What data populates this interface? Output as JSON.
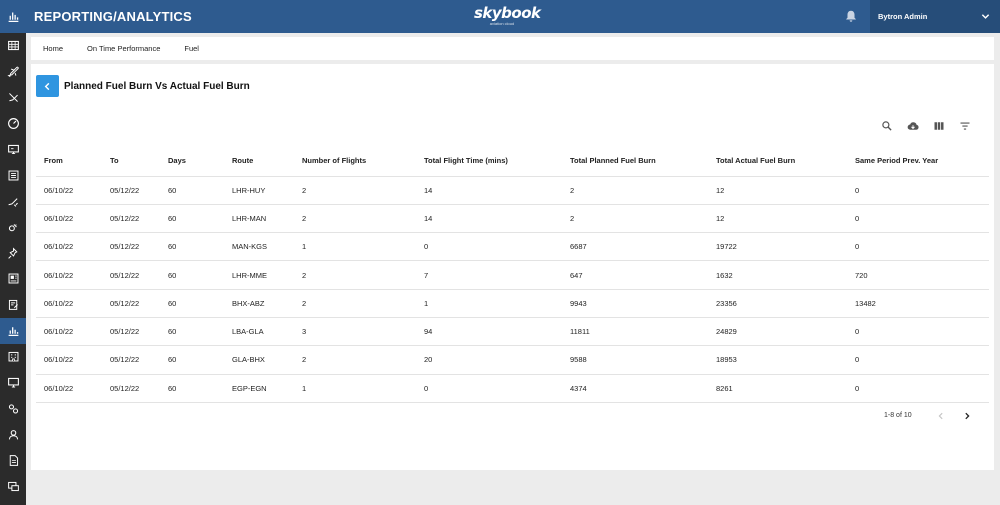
{
  "colors": {
    "header_blue": "#2e5b8f",
    "user_menu_blue": "#264d79",
    "sidebar_dark": "#2b2b2b",
    "accent_blue": "#2f95e0"
  },
  "header": {
    "app_title": "REPORTING/ANALYTICS",
    "brand_name": "skybook",
    "brand_sub": "aviation cloud",
    "user_name": "Bytron Admin",
    "icons": [
      "bell-icon",
      "chevron-down-icon"
    ]
  },
  "sidebar": {
    "logo_icon": "bar-chart-icon",
    "items": [
      {
        "icon": "grid-icon"
      },
      {
        "icon": "plane-icon"
      },
      {
        "icon": "plane-crossed-icon"
      },
      {
        "icon": "gauge-icon"
      },
      {
        "icon": "monitor-icon"
      },
      {
        "icon": "list-icon"
      },
      {
        "icon": "plane-tools-icon"
      },
      {
        "icon": "weather-icon"
      },
      {
        "icon": "pin-icon"
      },
      {
        "icon": "news-icon"
      },
      {
        "icon": "clipboard-edit-icon"
      },
      {
        "icon": "analytics-icon",
        "active": true
      },
      {
        "icon": "building-icon"
      },
      {
        "icon": "display-icon"
      },
      {
        "icon": "cogs-icon"
      },
      {
        "icon": "user-icon"
      },
      {
        "icon": "document-icon"
      },
      {
        "icon": "screens-icon"
      }
    ]
  },
  "breadcrumb": [
    "Home",
    "On Time Performance",
    "Fuel"
  ],
  "page": {
    "title": "Planned Fuel Burn Vs Actual Fuel Burn",
    "back_icon": "chevron-left-icon"
  },
  "toolbar": [
    "search-icon",
    "cloud-download-icon",
    "columns-icon",
    "filter-icon"
  ],
  "table": {
    "columns": [
      "From",
      "To",
      "Days",
      "Route",
      "Number of Flights",
      "Total Flight Time (mins)",
      "Total Planned Fuel Burn",
      "Total Actual Fuel Burn",
      "Same Period Prev. Year"
    ],
    "rows": [
      [
        "06/10/22",
        "05/12/22",
        "60",
        "LHR-HUY",
        "2",
        "14",
        "2",
        "12",
        "0"
      ],
      [
        "06/10/22",
        "05/12/22",
        "60",
        "LHR-MAN",
        "2",
        "14",
        "2",
        "12",
        "0"
      ],
      [
        "06/10/22",
        "05/12/22",
        "60",
        "MAN-KGS",
        "1",
        "0",
        "6687",
        "19722",
        "0"
      ],
      [
        "06/10/22",
        "05/12/22",
        "60",
        "LHR-MME",
        "2",
        "7",
        "647",
        "1632",
        "720"
      ],
      [
        "06/10/22",
        "05/12/22",
        "60",
        "BHX-ABZ",
        "2",
        "1",
        "9943",
        "23356",
        "13482"
      ],
      [
        "06/10/22",
        "05/12/22",
        "60",
        "LBA-GLA",
        "3",
        "94",
        "11811",
        "24829",
        "0"
      ],
      [
        "06/10/22",
        "05/12/22",
        "60",
        "GLA-BHX",
        "2",
        "20",
        "9588",
        "18953",
        "0"
      ],
      [
        "06/10/22",
        "05/12/22",
        "60",
        "EGP-EGN",
        "1",
        "0",
        "4374",
        "8261",
        "0"
      ]
    ]
  },
  "pagination": {
    "info": "1-8 of 10",
    "prev_icon": "chevron-left-icon",
    "next_icon": "chevron-right-icon"
  }
}
